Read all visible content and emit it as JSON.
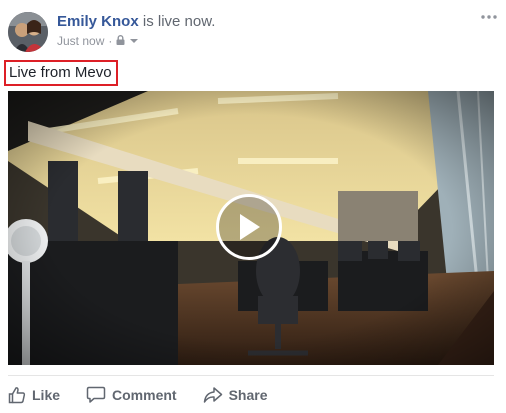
{
  "post": {
    "author": "Emily Knox",
    "status_text": " is live now.",
    "timestamp": "Just now",
    "separator": "·",
    "privacy_icon": "lock-icon",
    "menu_icon": "more-options-icon",
    "message": "Live from Mevo"
  },
  "video": {
    "play_icon": "play-icon",
    "description": "office live stream"
  },
  "actions": [
    {
      "label": "Like",
      "icon": "like-icon"
    },
    {
      "label": "Comment",
      "icon": "comment-icon"
    },
    {
      "label": "Share",
      "icon": "share-icon"
    }
  ],
  "colors": {
    "author_link": "#365899",
    "muted_text": "#616770",
    "highlight_border": "#dd1f26"
  }
}
